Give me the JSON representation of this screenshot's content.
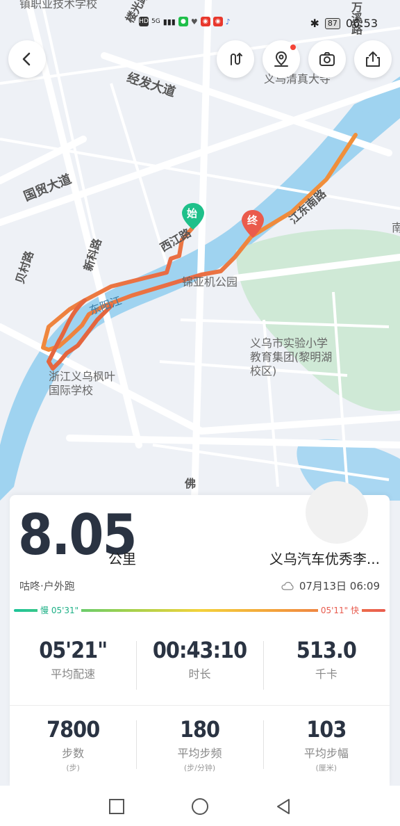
{
  "status_bar": {
    "time": "06:53",
    "battery": "87",
    "indicators": [
      "HD",
      "5G",
      "signal-bars",
      "wechat-icon",
      "heart-icon",
      "weibo-icon",
      "weibo-icon",
      "music-icon"
    ]
  },
  "map": {
    "road_labels": [
      "国贸大道",
      "经发大道",
      "新科路",
      "贝村路",
      "西江路",
      "江东南路",
      "佛",
      "万溪路",
      "楼光路"
    ],
    "poi_labels": [
      "镇职业技术学校",
      "义乌清真大寺",
      "锦亚机公园",
      "义乌市实验小学教育集团(黎明湖校区)",
      "浙江义乌枫叶国际学校",
      "东阳江",
      "南"
    ],
    "start_label": "始",
    "end_label": "终",
    "route_color_start": "#e85b4e",
    "route_color_end": "#f08a3c"
  },
  "toolbar": {
    "back": "back-icon",
    "buttons": [
      "route-switch-icon",
      "location-pin-icon",
      "camera-icon",
      "share-icon"
    ]
  },
  "summary": {
    "distance": "8.05",
    "distance_unit": "公里",
    "user_name": "义乌汽车优秀李...",
    "sport_type": "咕咚·户外跑",
    "date_time": "07月13日 06:09",
    "slow_pace": "慢 05'31\"",
    "fast_pace": "05'11\" 快"
  },
  "stats_row1": [
    {
      "value": "05'21\"",
      "label": "平均配速"
    },
    {
      "value": "00:43:10",
      "label": "时长"
    },
    {
      "value": "513.0",
      "label": "千卡"
    }
  ],
  "stats_row2": [
    {
      "value": "7800",
      "label": "步数",
      "unit": "(步)"
    },
    {
      "value": "180",
      "label": "平均步频",
      "unit": "(步/分钟)"
    },
    {
      "value": "103",
      "label": "平均步幅",
      "unit": "(厘米)"
    }
  ]
}
